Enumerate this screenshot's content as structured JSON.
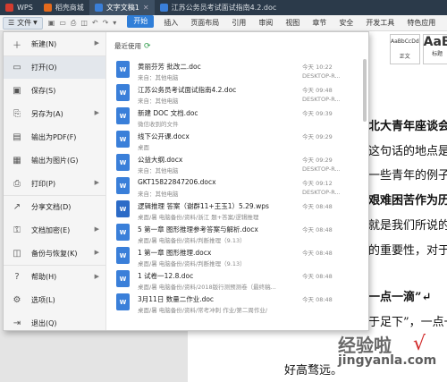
{
  "tabs": [
    {
      "label": "WPS",
      "color": "#d43c2f"
    },
    {
      "label": "稻壳商城",
      "color": "#e46a1c"
    },
    {
      "label": "文字文稿1",
      "color": "#3a7fd9"
    },
    {
      "label": "江苏公务员考试面试指南4.2.doc",
      "color": "#3a7fd9"
    }
  ],
  "menubar": {
    "file_label": "文件",
    "tabs": [
      "开始",
      "插入",
      "页面布局",
      "引用",
      "审阅",
      "视图",
      "章节",
      "安全",
      "开发工具",
      "特色应用"
    ]
  },
  "styles": {
    "normal_sample": "AaBbCcDd",
    "normal_label": "正文",
    "title_sample": "AaB",
    "title_label": "标题"
  },
  "left_menu": [
    {
      "label": "新建(N)",
      "icon": "new-icon",
      "glyph": "＋",
      "arrow": true
    },
    {
      "label": "打开(O)",
      "icon": "open-folder-icon",
      "glyph": "▭",
      "arrow": false
    },
    {
      "label": "保存(S)",
      "icon": "save-icon",
      "glyph": "▣",
      "arrow": false
    },
    {
      "label": "另存为(A)",
      "icon": "save-as-icon",
      "glyph": "⎘",
      "arrow": true
    },
    {
      "label": "输出为PDF(F)",
      "icon": "pdf-icon",
      "glyph": "▤",
      "arrow": false
    },
    {
      "label": "输出为图片(G)",
      "icon": "image-icon",
      "glyph": "▦",
      "arrow": false
    },
    {
      "label": "打印(P)",
      "icon": "print-icon",
      "glyph": "⎙",
      "arrow": true
    },
    {
      "label": "分享文档(D)",
      "icon": "share-icon",
      "glyph": "↗",
      "arrow": false
    },
    {
      "label": "文档加密(E)",
      "icon": "encrypt-icon",
      "glyph": "⚿",
      "arrow": true
    },
    {
      "label": "备份与恢复(K)",
      "icon": "backup-icon",
      "glyph": "◫",
      "arrow": true
    },
    {
      "label": "帮助(H)",
      "icon": "help-icon",
      "glyph": "?",
      "arrow": true
    },
    {
      "label": "选项(L)",
      "icon": "options-icon",
      "glyph": "⚙",
      "arrow": false
    },
    {
      "label": "退出(Q)",
      "icon": "exit-icon",
      "glyph": "⇥",
      "arrow": false
    }
  ],
  "recent": {
    "title": "最近使用",
    "items": [
      {
        "name": "黄丽芬芳 批改二.doc",
        "path": "来自：其他电脑",
        "time": "今天 10:22",
        "device": "DESKTOP-R..."
      },
      {
        "name": "江苏公务员考试面试指南4.2.doc",
        "path": "来自：其他电脑",
        "time": "今天 09:48",
        "device": "DESKTOP-R..."
      },
      {
        "name": "新建 DOC 文档.doc",
        "path": "微信收到的文件",
        "time": "今天 09:39",
        "device": ""
      },
      {
        "name": "线下公开课.docx",
        "path": "桌面",
        "time": "今天 09:29",
        "device": ""
      },
      {
        "name": "公益大纲.docx",
        "path": "来自：其他电脑",
        "time": "今天 09:29",
        "device": "DESKTOP-R..."
      },
      {
        "name": "GKT15822847206.docx",
        "path": "来自：其他电脑",
        "time": "今天 09:12",
        "device": "DESKTOP-R..."
      },
      {
        "name": "逻辑推理 答案（谢群11+王玉1）5.29.wps",
        "path": "桌面/暑 电脑备份/资料/浙江 题+答案/逻辑推理",
        "time": "今天 08:48",
        "device": ""
      },
      {
        "name": "5 第一章 图形推理参考答案与解析.docx",
        "path": "桌面/暑 电脑备份/资料/判断推理（9.13）",
        "time": "今天 08:48",
        "device": ""
      },
      {
        "name": "1 第一章 图形推理.docx",
        "path": "桌面/暑 电脑备份/资料/判断推理（9.13）",
        "time": "今天 08:48",
        "device": ""
      },
      {
        "name": "1 试卷一12.8.doc",
        "path": "桌面/暑 电脑备份/资料/2018版行测预测卷（最终稿...",
        "time": "今天 08:48",
        "device": ""
      },
      {
        "name": "3月11日 数量二作业.doc",
        "path": "桌面/暑 电脑备份/资料/常考冲刺 作业/第二周作业/",
        "time": "今天 08:48",
        "device": ""
      },
      {
        "name": "",
        "path": "",
        "time": "",
        "device": ""
      }
    ]
  },
  "document": {
    "lines": [
      {
        "text": "北大青年座谈会上",
        "bold": true
      },
      {
        "text": "这句话的地点是北",
        "bold": false
      },
      {
        "text": "一些青年的例子作",
        "bold": false
      },
      {
        "text": "艰难困苦作为历练",
        "bold": true
      },
      {
        "text": "就是我们所说的困",
        "bold": false
      },
      {
        "text": "的重要性，对于青",
        "bold": false
      },
      {
        "text": "一点一滴”↵",
        "bold": true
      },
      {
        "text": "于足下”，一点一",
        "bold": false
      },
      {
        "text": "好高骛远。",
        "bold": false
      }
    ]
  },
  "watermark": {
    "line1": "经验啦",
    "line2": "jingyanla.com",
    "check": "√"
  }
}
